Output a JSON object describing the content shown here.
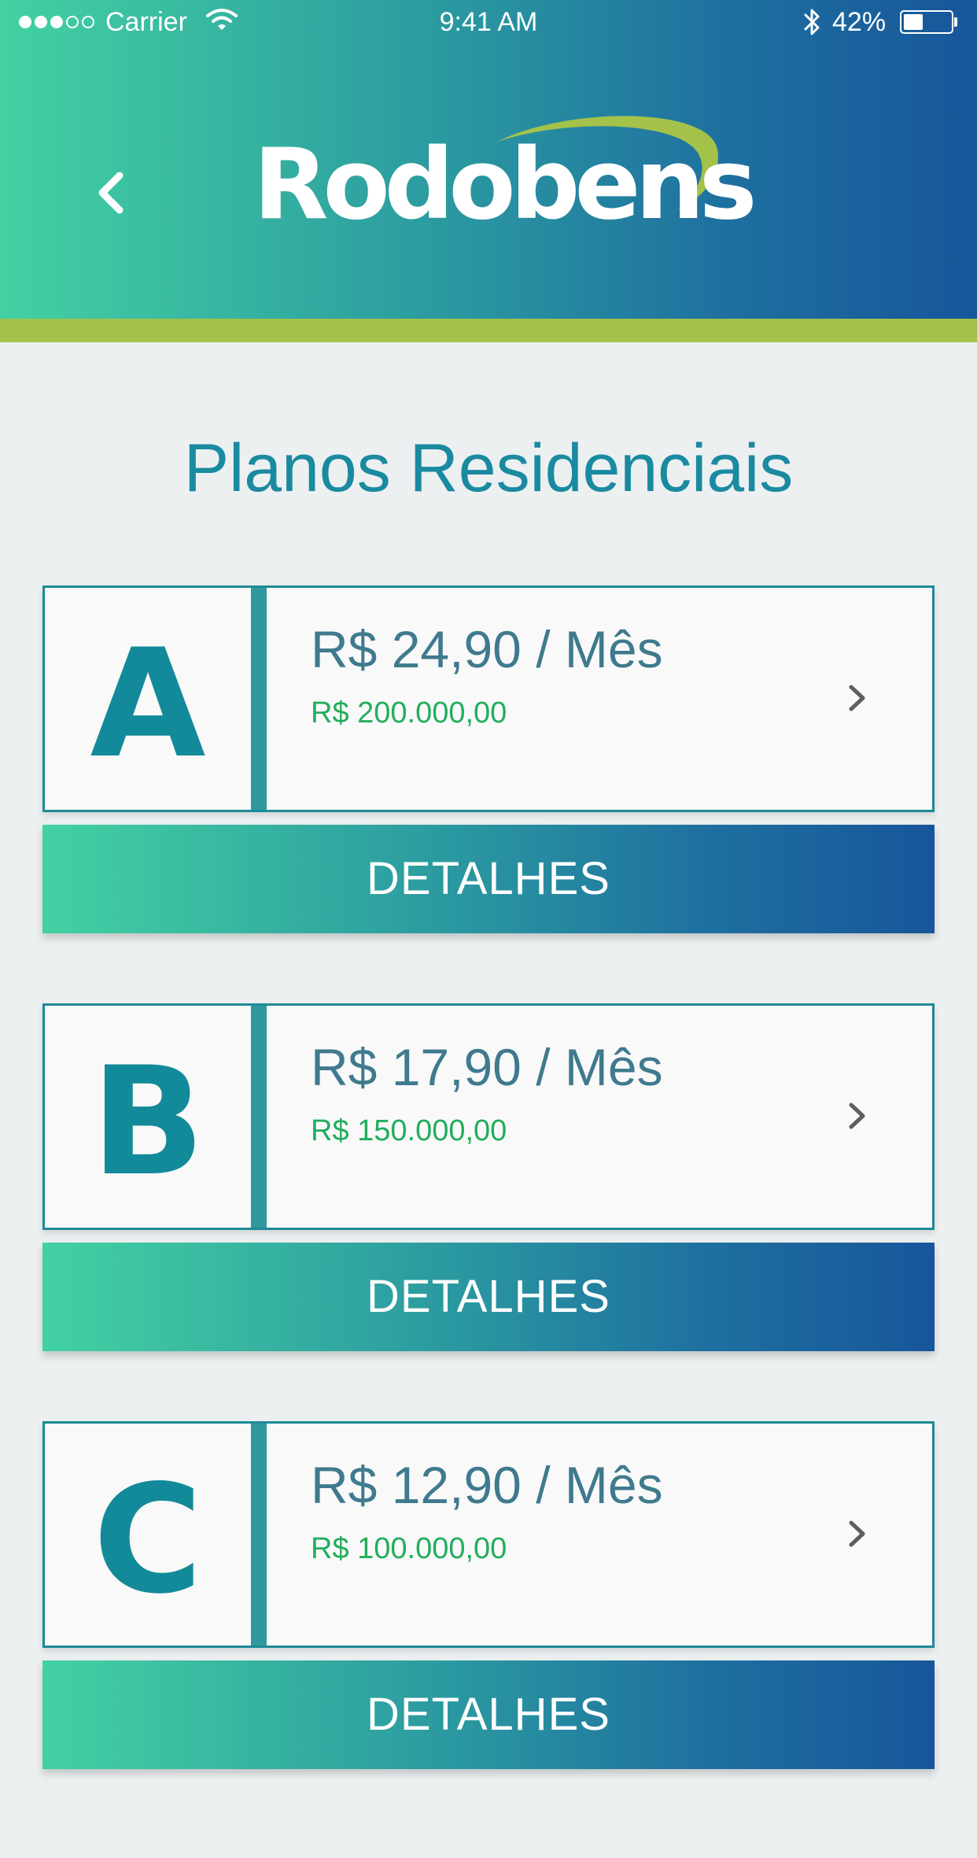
{
  "status_bar": {
    "carrier": "Carrier",
    "time": "9:41 AM",
    "battery_text": "42%",
    "battery_level": 0.42,
    "signal_bars_filled": 3,
    "signal_bars_total": 5
  },
  "header": {
    "logo_text": "Rodobens",
    "back_icon": "chevron-left-icon",
    "colors": {
      "gradient_start": "#43d1a2",
      "gradient_end": "#17569a",
      "accent_stripe": "#a4c24a"
    }
  },
  "page": {
    "title": "Planos Residenciais"
  },
  "plans": [
    {
      "letter": "A",
      "price": "R$ 24,90 / Mês",
      "coverage": "R$ 200.000,00",
      "details_label": "DETALHES"
    },
    {
      "letter": "B",
      "price": "R$ 17,90 / Mês",
      "coverage": "R$ 150.000,00",
      "details_label": "DETALHES"
    },
    {
      "letter": "C",
      "price": "R$ 12,90 / Mês",
      "coverage": "R$ 100.000,00",
      "details_label": "DETALHES"
    }
  ]
}
